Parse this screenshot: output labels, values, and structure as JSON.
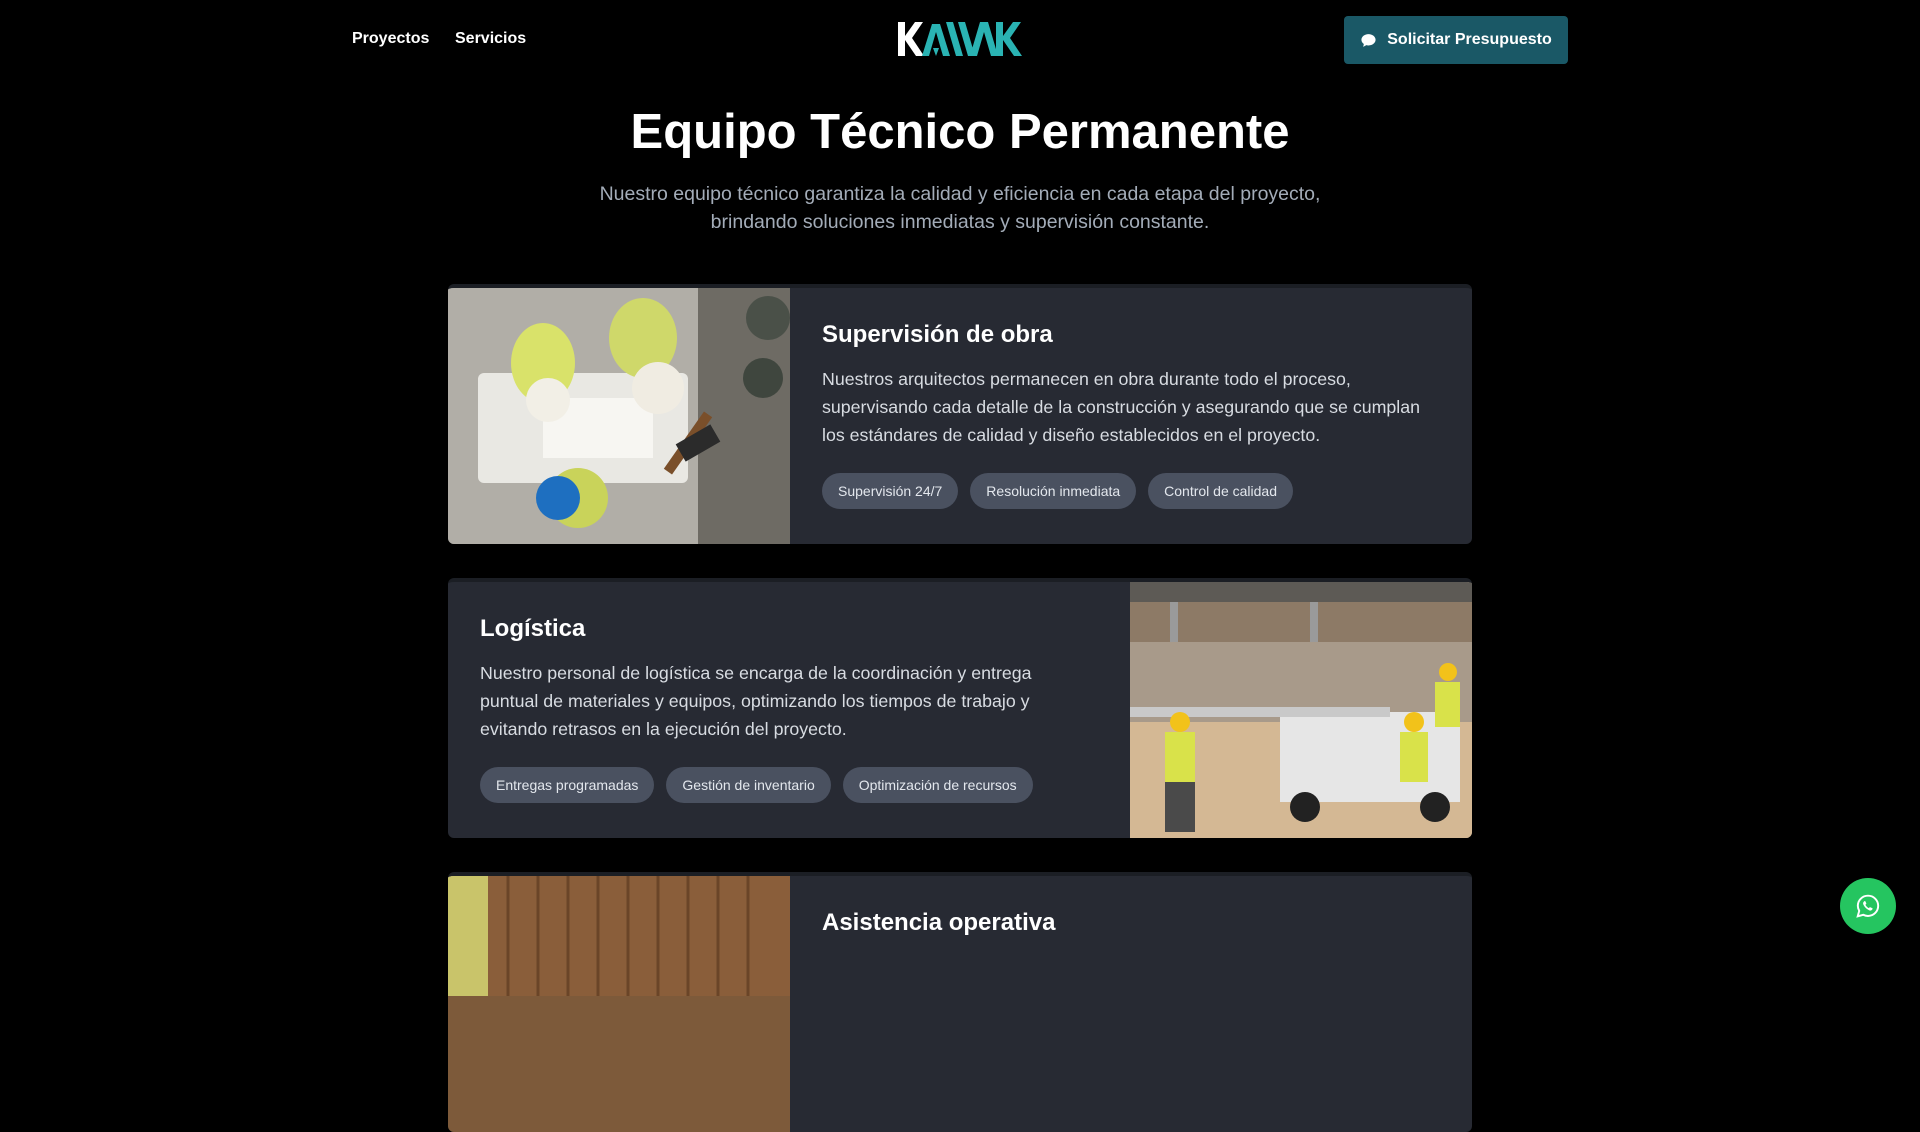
{
  "nav": {
    "links": [
      "Proyectos",
      "Servicios"
    ],
    "logo_text": "KAMAK",
    "cta_label": "Solicitar Presupuesto",
    "cta_icon": "chat-bubble-icon"
  },
  "section": {
    "title": "Equipo Técnico Permanente",
    "subtitle": "Nuestro equipo técnico garantiza la calidad y eficiencia en cada etapa del proyecto, brindando soluciones inmediatas y supervisión constante."
  },
  "cards": [
    {
      "title": "Supervisión de obra",
      "description": "Nuestros arquitectos permanecen en obra durante todo el proceso, supervisando cada detalle de la construcción y asegurando que se cumplan los estándares de calidad y diseño establecidos en el proyecto.",
      "tags": [
        "Supervisión 24/7",
        "Resolución inmediata",
        "Control de calidad"
      ]
    },
    {
      "title": "Logística",
      "description": "Nuestro personal de logística se encarga de la coordinación y entrega puntual de materiales y equipos, optimizando los tiempos de trabajo y evitando retrasos en la ejecución del proyecto.",
      "tags": [
        "Entregas programadas",
        "Gestión de inventario",
        "Optimización de recursos"
      ]
    },
    {
      "title": "Asistencia operativa"
    }
  ],
  "colors": {
    "background": "#000000",
    "card": "#272a33",
    "tag": "#4a5160",
    "cta": "#1a5866",
    "logo_accent": "#2ab3b3",
    "whatsapp": "#25c560"
  },
  "floating": {
    "icon": "whatsapp-icon"
  }
}
